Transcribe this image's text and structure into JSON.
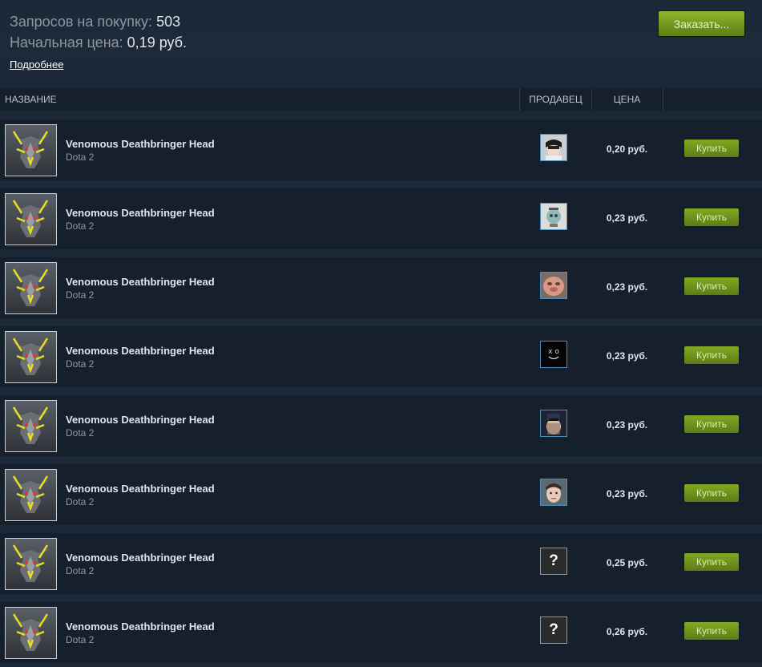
{
  "summary": {
    "requests_label": "Запросов на покупку:",
    "requests_value": "503",
    "start_price_label": "Начальная цена:",
    "start_price_value": "0,19 руб.",
    "more_link": "Подробнее",
    "order_button": "Заказать..."
  },
  "table": {
    "col_name": "НАЗВАНИЕ",
    "col_seller": "ПРОДАВЕЦ",
    "col_price": "ЦЕНА",
    "buy_label": "Купить",
    "listings": [
      {
        "name": "Venomous Deathbringer Head",
        "game": "Dota 2",
        "price": "0,20 руб.",
        "seller_avatar": "seller-avatar-1"
      },
      {
        "name": "Venomous Deathbringer Head",
        "game": "Dota 2",
        "price": "0,23 руб.",
        "seller_avatar": "seller-avatar-2"
      },
      {
        "name": "Venomous Deathbringer Head",
        "game": "Dota 2",
        "price": "0,23 руб.",
        "seller_avatar": "seller-avatar-3"
      },
      {
        "name": "Venomous Deathbringer Head",
        "game": "Dota 2",
        "price": "0,23 руб.",
        "seller_avatar": "seller-avatar-4"
      },
      {
        "name": "Venomous Deathbringer Head",
        "game": "Dota 2",
        "price": "0,23 руб.",
        "seller_avatar": "seller-avatar-5"
      },
      {
        "name": "Venomous Deathbringer Head",
        "game": "Dota 2",
        "price": "0,23 руб.",
        "seller_avatar": "seller-avatar-6"
      },
      {
        "name": "Venomous Deathbringer Head",
        "game": "Dota 2",
        "price": "0,25 руб.",
        "seller_avatar": "unknown-avatar",
        "avatar_text": "?"
      },
      {
        "name": "Venomous Deathbringer Head",
        "game": "Dota 2",
        "price": "0,26 руб.",
        "seller_avatar": "unknown-avatar",
        "avatar_text": "?"
      }
    ]
  }
}
